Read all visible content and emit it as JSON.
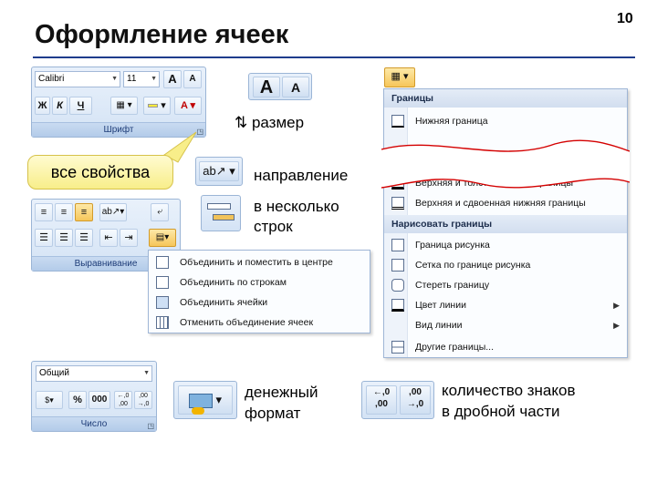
{
  "slide": {
    "title": "Оформление ячеек",
    "page_number": "10"
  },
  "font_group": {
    "label": "Шрифт",
    "font_name": "Calibri",
    "font_size": "11",
    "grow": "A",
    "shrink": "A",
    "bold": "Ж",
    "italic": "К",
    "underline": "Ч",
    "font_color": "A"
  },
  "size_buttons": {
    "grow": "A",
    "shrink": "A",
    "caption": "⇅ размер"
  },
  "callout": "все свойства",
  "align_group": {
    "label": "Выравнивание"
  },
  "captions": {
    "direction": "направление",
    "wrap_line1": "в несколько",
    "wrap_line2": "строк",
    "money_line1": "денежный",
    "money_line2": "формат",
    "decimals_line1": "количество знаков",
    "decimals_line2": "в дробной части"
  },
  "merge_menu": {
    "items": [
      "Объединить и поместить в центре",
      "Объединить по строкам",
      "Объединить ячейки",
      "Отменить объединение ячеек"
    ]
  },
  "number_group": {
    "label": "Число",
    "format": "Общий",
    "percent": "%",
    "thousands": "000",
    "inc_decimal": "←,0 ,00",
    "dec_decimal": ",00 →,0"
  },
  "borders_menu": {
    "header": "Границы",
    "top_items": [
      "Нижняя граница"
    ],
    "mid_items": [
      "Верхняя и толстая нижняя границы",
      "Верхняя и сдвоенная нижняя границы"
    ],
    "draw_header": "Нарисовать границы",
    "draw_items": [
      "Граница рисунка",
      "Сетка по границе рисунка",
      "Стереть границу",
      "Цвет линии",
      "Вид линии"
    ],
    "other": "Другие границы..."
  },
  "colors": {
    "accent_rule": "#1e3c8c",
    "callout_fill": "#f8ee8a",
    "wave_line": "#d40000"
  }
}
